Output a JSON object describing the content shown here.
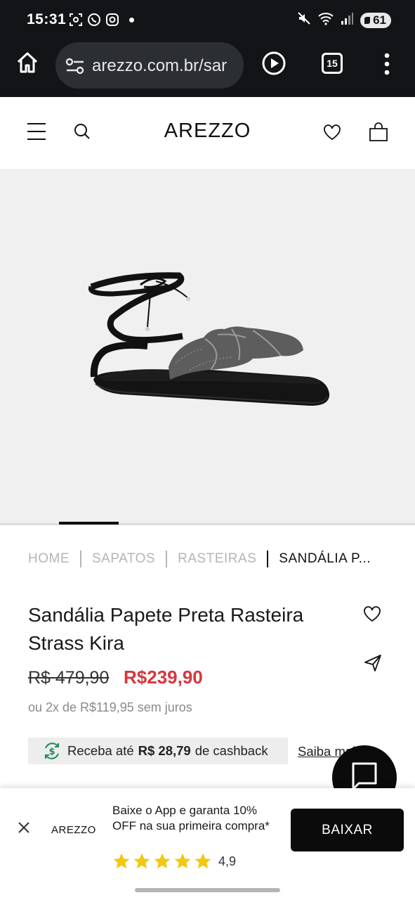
{
  "status_bar": {
    "time": "15:31",
    "battery": "61"
  },
  "browser": {
    "url": "arezzo.com.br/sar",
    "tab_count": "15"
  },
  "site": {
    "logo": "AREZZO"
  },
  "breadcrumb": [
    {
      "label": "HOME"
    },
    {
      "label": "SAPATOS"
    },
    {
      "label": "RASTEIRAS"
    },
    {
      "label": "SANDÁLIA P..."
    }
  ],
  "product": {
    "title": "Sandália Papete Preta Rasteira Strass Kira",
    "old_price": "R$ 479,90",
    "price": "R$239,90",
    "installments": "ou 2x de R$119,95 sem juros",
    "cashback": {
      "prefix": "Receba até",
      "amount": "R$ 28,79",
      "suffix": "de cashback",
      "link": "Saiba mais"
    }
  },
  "carousel": {
    "active_fraction_start": 0.142,
    "active_fraction_end": 0.286
  },
  "app_banner": {
    "logo": "AREZZO",
    "text": "Baixe o App e garanta 10% OFF na sua primeira compra*",
    "rating": "4,9",
    "stars": 5,
    "button": "BAIXAR"
  },
  "colors": {
    "sale_price": "#d6363d",
    "star": "#f2c811",
    "cashback_icon": "#1f8a5a",
    "dark": "#0b0b0b"
  }
}
